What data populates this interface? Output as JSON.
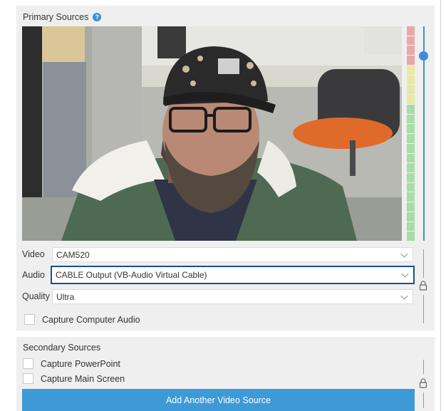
{
  "primary": {
    "title": "Primary Sources",
    "video_label": "Video",
    "video_value": "CAM520",
    "audio_label": "Audio",
    "audio_value": "CABLE Output (VB-Audio Virtual Cable)",
    "quality_label": "Quality",
    "quality_value": "Ultra",
    "capture_audio_label": "Capture Computer Audio",
    "capture_audio_checked": false
  },
  "secondary": {
    "title": "Secondary Sources",
    "capture_powerpoint_label": "Capture PowerPoint",
    "capture_powerpoint_checked": false,
    "capture_screen_label": "Capture Main Screen",
    "capture_screen_checked": false,
    "add_button_label": "Add Another Video Source"
  },
  "colors": {
    "accent": "#3a8fd8",
    "button": "#3e9ad6",
    "focus_border": "#1e4e8c",
    "meter_red": "#e8a8a8",
    "meter_yellow": "#e8e8a0",
    "meter_green": "#a8dca8"
  }
}
